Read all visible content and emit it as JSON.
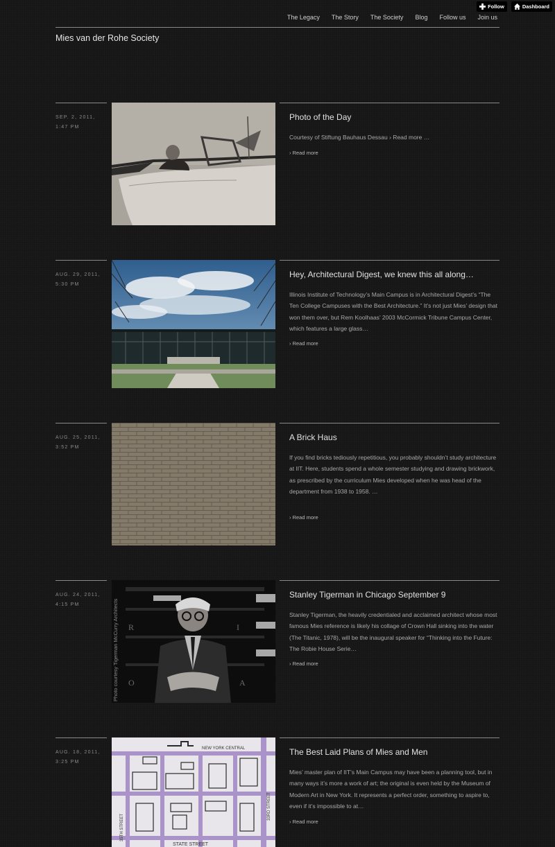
{
  "topbar": {
    "follow_label": "Follow",
    "dashboard_label": "Dashboard"
  },
  "nav": [
    "The Legacy",
    "The Story",
    "The Society",
    "Blog",
    "Follow us",
    "Join us"
  ],
  "site_title": "Mies van der Rohe Society",
  "read_more_label": "› Read more",
  "posts": [
    {
      "date_line1": "SEP. 2, 2011,",
      "date_line2": "1:47 PM",
      "title": "Photo of the Day",
      "excerpt": "Courtesy of Stiftung Bauhaus Dessau › Read more …"
    },
    {
      "date_line1": "AUG. 29, 2011,",
      "date_line2": "5:30 PM",
      "title": "Hey, Architectural Digest, we knew this all along…",
      "excerpt": "Illinois Institute of Technology’s Main Campus is in Architectural Digest’s “The Ten College Campuses with the Best Architecture.” It’s not just Mies’ design that won them over, but Rem Koolhaas’ 2003 McCormick Tribune Campus Center, which features a large glass…"
    },
    {
      "date_line1": "AUG. 25, 2011,",
      "date_line2": "3:52 PM",
      "title": "A Brick Haus",
      "excerpt": "If you find bricks tediously repetitious, you probably shouldn’t study architecture at IIT. Here, students spend a whole semester studying and drawing brickwork, as prescribed by the curriculum Mies developed when he was head of the department from 1938 to 1958. …"
    },
    {
      "date_line1": "AUG. 24, 2011,",
      "date_line2": "4:15 PM",
      "title": "Stanley Tigerman in Chicago September 9",
      "excerpt": "Stanley Tigerman, the heavily credentialed and acclaimed architect whose most famous Mies reference is likely his collage of Crown Hall sinking into the water (The Titanic, 1978), will be the inaugural speaker for “Thinking into the Future: The Robie House Serie…",
      "photo_credit": "Photo courtesy Tigerman McCurry Architects",
      "photo_letters": [
        "R",
        "I",
        "O",
        "A"
      ]
    },
    {
      "date_line1": "AUG. 18, 2011,",
      "date_line2": "3:25 PM",
      "title": "The Best Laid Plans of Mies and Men",
      "excerpt": "Mies’ master plan of IIT’s Main Campus may have been a planning tool, but in many ways it’s more a work of art; the original is even held by the Museum of Modern Art in New York. It represents a perfect order, something to aspire to, even if it’s impossible to at…",
      "map_labels": [
        "NEW YORK CENTRAL",
        "STATE STREET",
        "33RD STREET",
        "35TH STREET"
      ]
    }
  ]
}
